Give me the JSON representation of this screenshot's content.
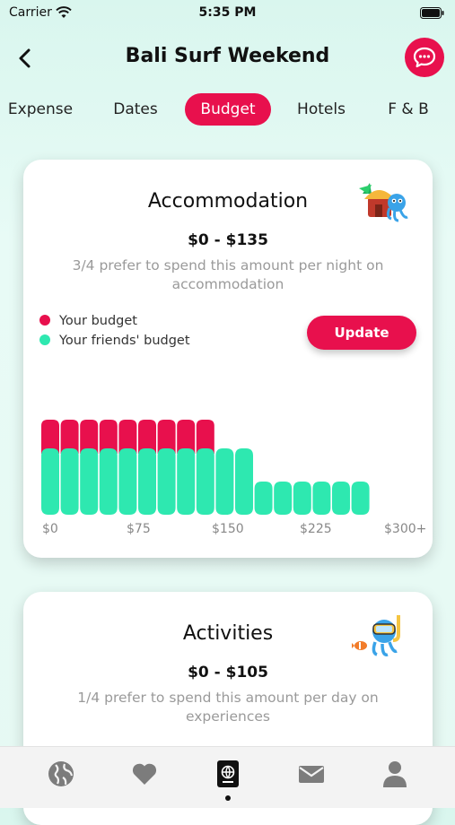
{
  "status_bar": {
    "carrier": "Carrier",
    "time": "5:35 PM"
  },
  "header": {
    "title": "Bali Surf Weekend"
  },
  "tabs": [
    {
      "label": "Expense",
      "active": false
    },
    {
      "label": "Dates",
      "active": false
    },
    {
      "label": "Budget",
      "active": true
    },
    {
      "label": "Hotels",
      "active": false
    },
    {
      "label": "F & B",
      "active": false
    }
  ],
  "accommodation": {
    "title": "Accommodation",
    "range": "$0 - $135",
    "description": "3/4 prefer to spend this amount per night on accommodation",
    "legend": {
      "your_budget": "Your budget",
      "friends_budget": "Your friends' budget"
    },
    "update_label": "Update",
    "colors": {
      "your_budget": "#e8104d",
      "friends_budget": "#2ee8b0"
    },
    "chart_data": {
      "type": "bar",
      "x_tick_labels": [
        "$0",
        "$75",
        "$150",
        "$225",
        "$300+"
      ],
      "series": [
        {
          "name": "Your budget",
          "values": [
            1,
            1,
            1,
            1,
            1,
            1,
            1,
            1,
            1,
            0,
            0,
            0,
            0,
            0,
            0,
            0,
            0
          ]
        },
        {
          "name": "Your friends' budget",
          "values": [
            1,
            1,
            1,
            1,
            1,
            1,
            1,
            1,
            1,
            1,
            1,
            0.5,
            0.5,
            0.5,
            0.5,
            0.5,
            0.5
          ]
        }
      ]
    }
  },
  "activities": {
    "title": "Activities",
    "range": "$0 - $105",
    "description": "1/4 prefer to spend this amount per day on experiences"
  },
  "tab_bar": {
    "items": [
      "globe-icon",
      "heart-icon",
      "passport-icon",
      "mail-icon",
      "person-icon"
    ],
    "active_index": 2
  }
}
